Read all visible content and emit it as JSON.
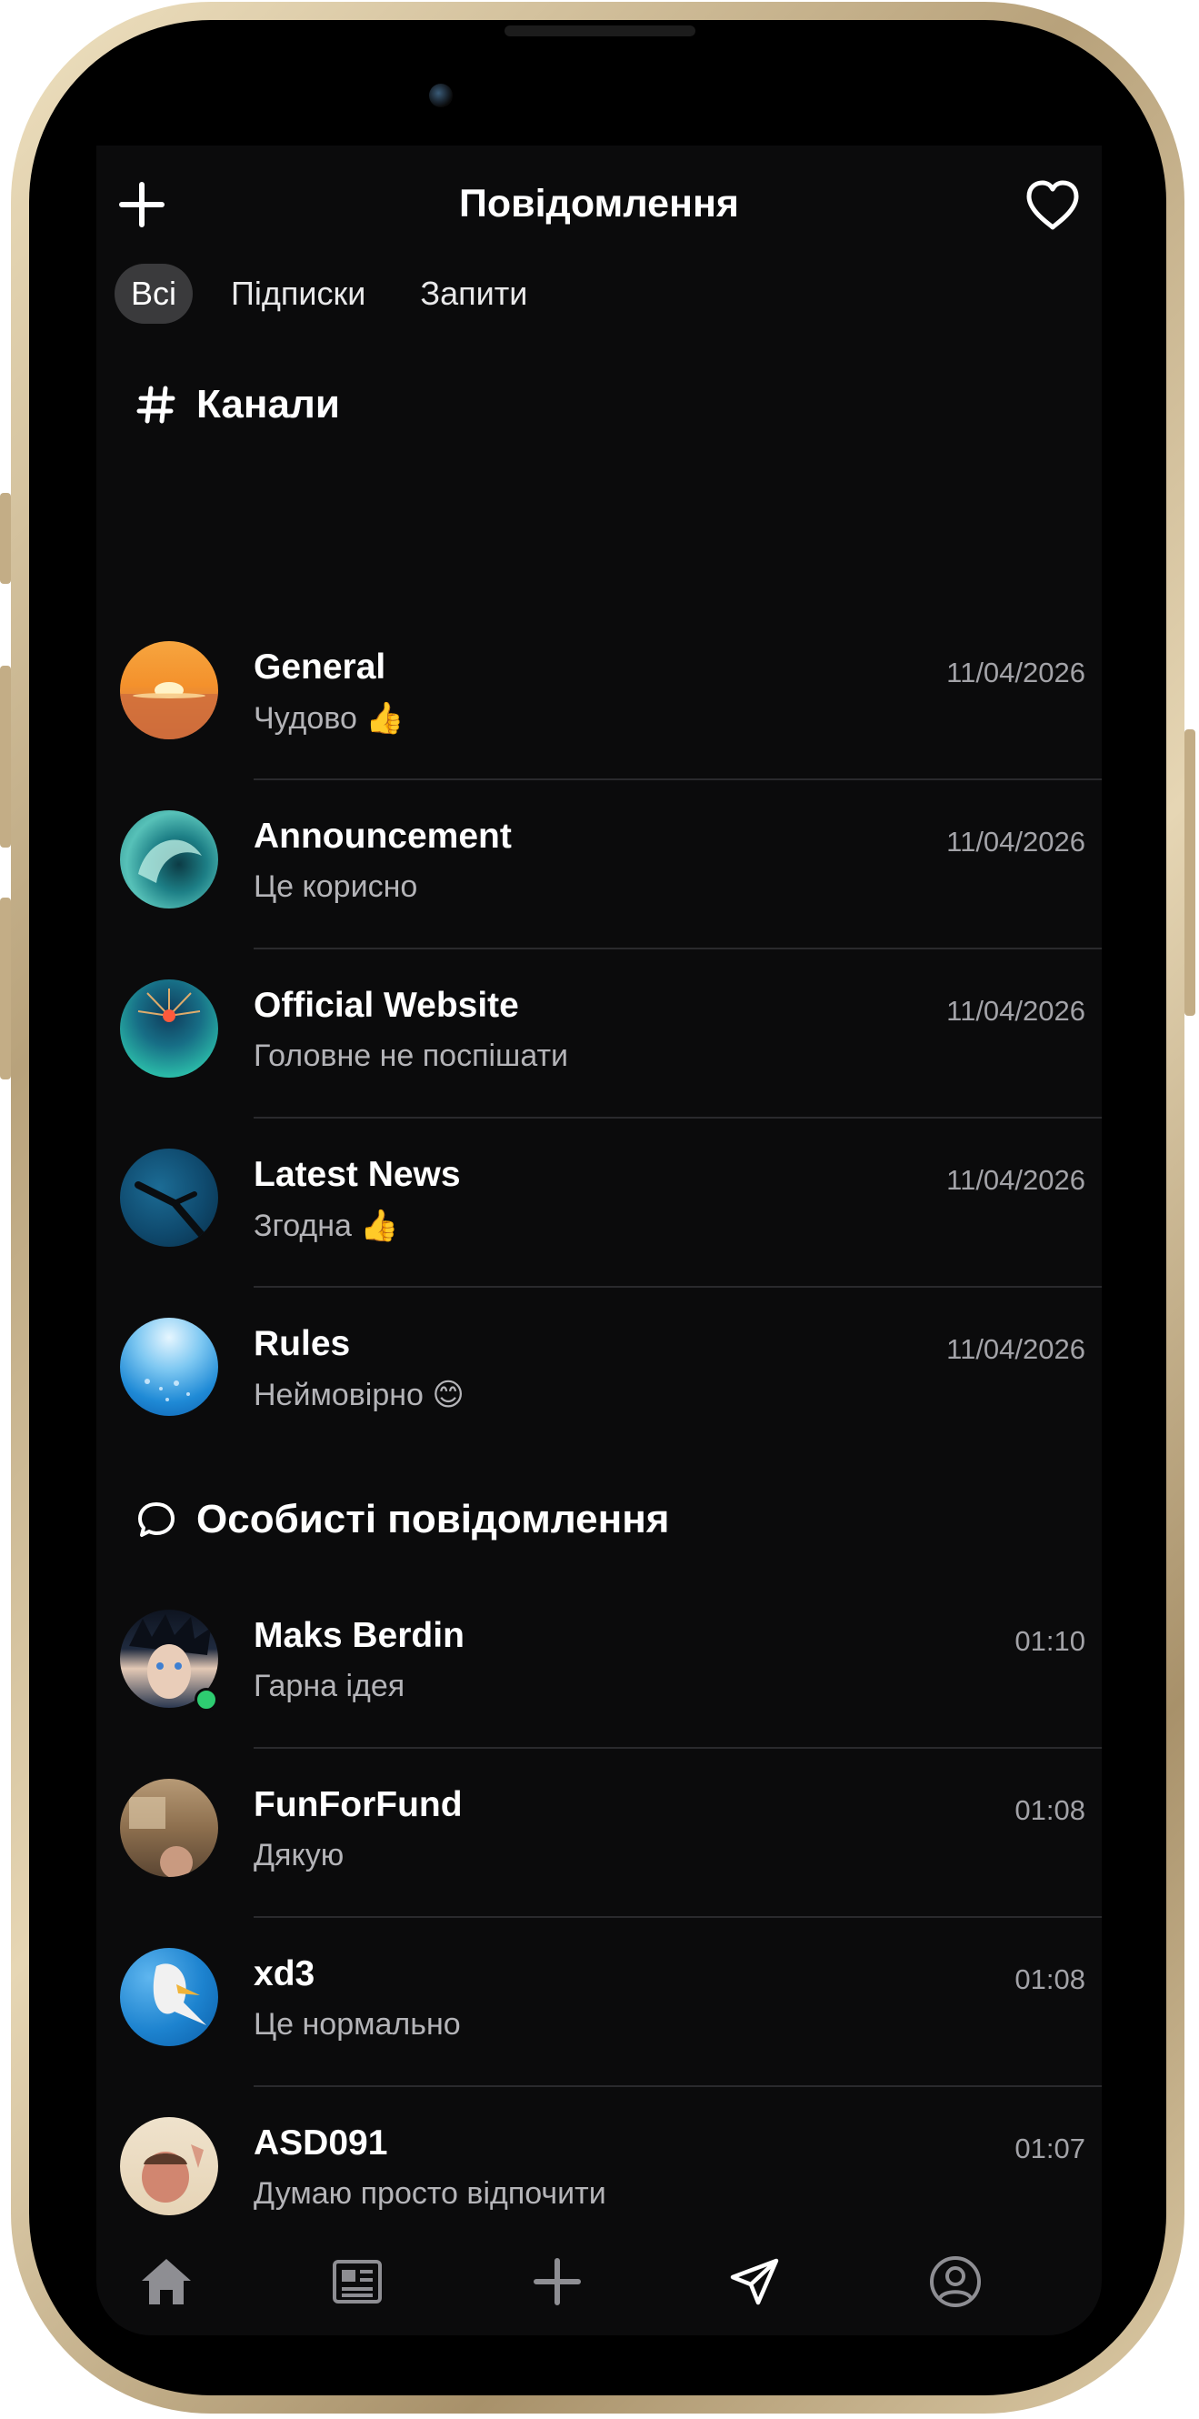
{
  "header": {
    "title": "Повідомлення",
    "add_icon": "plus-icon",
    "favorites_icon": "heart-outline-icon"
  },
  "tabs": [
    {
      "label": "Всі",
      "active": true
    },
    {
      "label": "Підписки",
      "active": false
    },
    {
      "label": "Запити",
      "active": false
    }
  ],
  "channels_section": {
    "title": "Канали",
    "icon": "hash-icon",
    "items": [
      {
        "name": "General",
        "message": "Чудово 👍",
        "time": "11/04/2026",
        "avatar": "sunset-photo"
      },
      {
        "name": "Announcement",
        "message": "Це корисно",
        "time": "11/04/2026",
        "avatar": "wave-photo"
      },
      {
        "name": "Official Website",
        "message": "Головне не поспішати",
        "time": "11/04/2026",
        "avatar": "coral-photo"
      },
      {
        "name": "Latest News",
        "message": "Згодна 👍",
        "time": "11/04/2026",
        "avatar": "diver-photo"
      },
      {
        "name": "Rules",
        "message": "Неймовірно 😊",
        "time": "11/04/2026",
        "avatar": "underwater-photo"
      }
    ]
  },
  "direct_section": {
    "title": "Особисті повідомлення",
    "icon": "chat-bubble-icon",
    "items": [
      {
        "name": "Maks Berdin",
        "message": "Гарна ідея",
        "time": "01:10",
        "avatar": "anime-portrait",
        "online": true
      },
      {
        "name": "FunForFund",
        "message": "Дякую",
        "time": "01:08",
        "avatar": "room-photo",
        "online": false
      },
      {
        "name": "xd3",
        "message": "Це нормально",
        "time": "01:08",
        "avatar": "seagull-photo",
        "online": false
      },
      {
        "name": "ASD091",
        "message": "Думаю просто відпочити",
        "time": "01:07",
        "avatar": "selfie-photo",
        "online": false
      }
    ]
  },
  "bottom_nav": [
    {
      "icon": "home-icon",
      "active": false
    },
    {
      "icon": "news-icon",
      "active": false
    },
    {
      "icon": "plus-icon",
      "active": false
    },
    {
      "icon": "send-icon",
      "active": true
    },
    {
      "icon": "profile-icon",
      "active": false
    }
  ],
  "colors": {
    "background": "#0b0b0c",
    "active_tab": "#3a3a3c",
    "separator": "#2a2a2d",
    "muted_text": "#b4b4b8",
    "online": "#2ecc71",
    "frame": "#c9b48e"
  }
}
